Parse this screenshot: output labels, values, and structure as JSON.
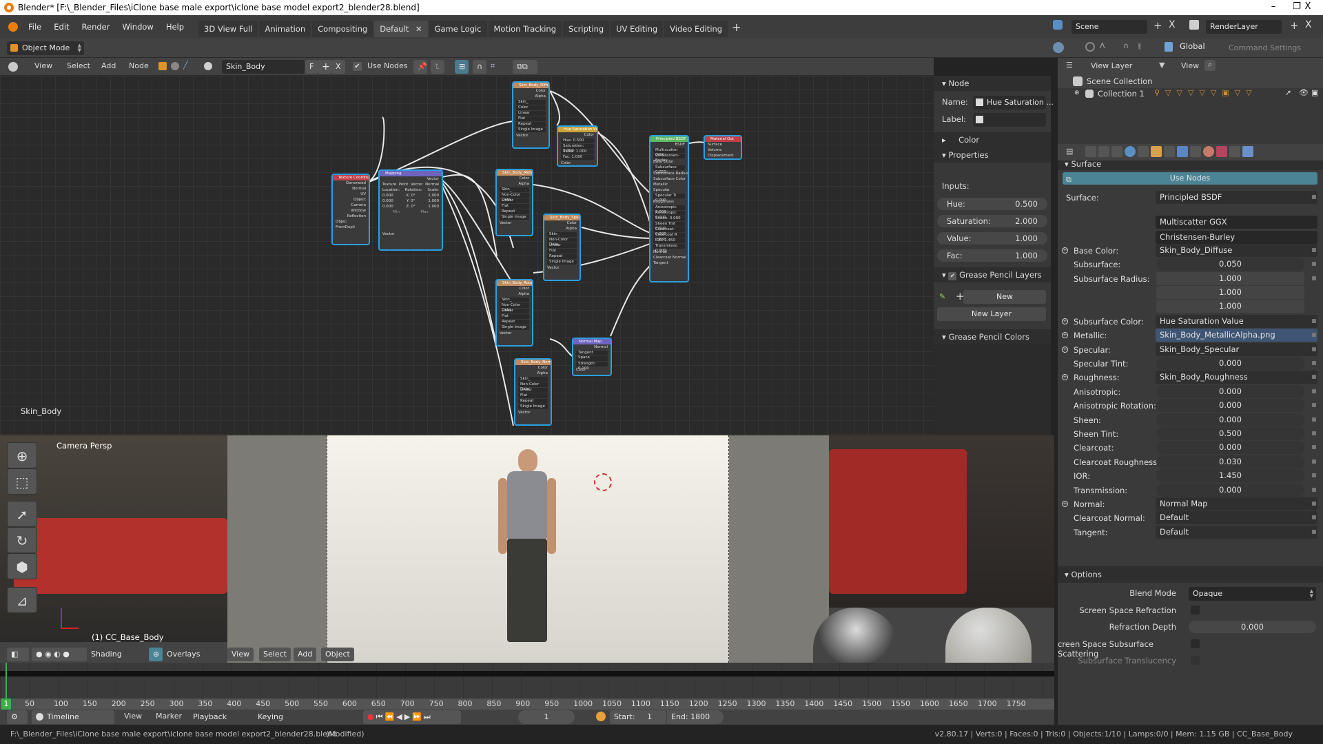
{
  "window": {
    "title": "Blender* [F:\\_Blender_Files\\iClone base male export\\iclone base model export2_blender28.blend]",
    "minimize": "–",
    "maximize": "❐",
    "close": "X"
  },
  "menu": [
    "File",
    "Edit",
    "Render",
    "Window",
    "Help"
  ],
  "workspaces": [
    {
      "label": "3D View Full"
    },
    {
      "label": "Animation"
    },
    {
      "label": "Compositing"
    },
    {
      "label": "Default",
      "active": true,
      "close": "✕"
    },
    {
      "label": "Game Logic"
    },
    {
      "label": "Motion Tracking"
    },
    {
      "label": "Scripting"
    },
    {
      "label": "UV Editing"
    },
    {
      "label": "Video Editing"
    }
  ],
  "add_workspace": "+",
  "scene": {
    "name": "Scene",
    "render_layer": "RenderLayer",
    "add": "+",
    "remove": "X"
  },
  "header2": {
    "mode": "Object Mode",
    "transform_orientation": "Global",
    "command_settings": "Command Settings"
  },
  "node_header": {
    "menus": [
      "View",
      "Select",
      "Add",
      "Node"
    ],
    "material": "Skin_Body",
    "fake_user": "F",
    "new": "+",
    "unlink": "X",
    "use_nodes": "Use Nodes",
    "use_nodes_checked": true
  },
  "node_editor": {
    "label": "Skin_Body",
    "nodes": {
      "texcoord": {
        "title": "Texture Coordinate",
        "outputs": [
          "Generated",
          "Normal",
          "UV",
          "Object",
          "Camera",
          "Window",
          "Reflection"
        ],
        "object_label": "Objec:",
        "from_dupli": "FromDupli"
      },
      "mapping": {
        "title": "Mapping",
        "out": "Vector",
        "tabs": [
          "Texture",
          "Point",
          "Vector",
          "Normal"
        ],
        "loc_label": "Location:",
        "rot_label": "Rotation:",
        "scale_label": "Scale:",
        "loc": [
          "0.000",
          "0.000",
          "0.000"
        ],
        "rot": [
          "X: 0°",
          "Y: 0°",
          "Z: 0°"
        ],
        "scale": [
          "1.000",
          "1.000",
          "1.000"
        ],
        "min": "Min",
        "max": "Max",
        "in": "Vector"
      },
      "diffuse": {
        "title": "Skin_Body_Diffuse",
        "opts": [
          "Color",
          "Linear",
          "Flat",
          "Repeat",
          "Single Image"
        ]
      },
      "metallic": {
        "title": "Skin_Body_Metallic",
        "opts": [
          "Non-Color Data",
          "Linear",
          "Flat",
          "Repeat",
          "Single Image"
        ]
      },
      "specular": {
        "title": "Skin_Body_Specul",
        "opts": [
          "Non-Color Data",
          "Linear",
          "Flat",
          "Repeat",
          "Single Image"
        ]
      },
      "rough": {
        "title": "Skin_Body_Rough",
        "opts": [
          "Non-Color Data",
          "Linear",
          "Flat",
          "Repeat",
          "Single Image"
        ]
      },
      "normal_tex": {
        "title": "Skin_Body_Normal",
        "opts": [
          "Non-Color Data",
          "Linear",
          "Flat",
          "Repeat",
          "Single Image"
        ]
      },
      "hsv": {
        "title": "Hue Saturation Val...",
        "out": "Color",
        "rows": [
          "Hue: 0.500",
          "Saturation: 2.000",
          "Value: 1.000",
          "Fac: 1.000"
        ],
        "in": "Color"
      },
      "normal_map": {
        "title": "Normal Map",
        "out": "Normal",
        "space": "Tangent Space",
        "strength": "Strength: 0.100",
        "in": "Color"
      },
      "bsdf": {
        "title": "Principled BSDF",
        "out": "BSDF",
        "rows": [
          "Multiscatter GGX",
          "Christensen-Burley",
          "Base Color",
          "Subsurface 0.050",
          "Subsurface Radius",
          "Subsurface Color",
          "Metallic",
          "Specular",
          "Specular Ti 0.000",
          "Roughness",
          "Anisotropic 0.000",
          "Anisotropic 0.000",
          "Sheen: 0.000",
          "Sheen Tint 0.500",
          "Clearcoat: 0.000",
          "Clearcoat R 0.030",
          "IOR: 1.450",
          "Transmissio 0.000",
          "Normal",
          "Clearcoat Normal",
          "Tangent"
        ]
      },
      "output": {
        "title": "Material Out",
        "rows": [
          "Surface",
          "Volume",
          "Displacement"
        ]
      },
      "common": {
        "color": "Color",
        "alpha": "Alpha",
        "vector": "Vector",
        "img": "Skin_"
      }
    }
  },
  "npanel": {
    "node_section": "Node",
    "name_label": "Name:",
    "name_value": "Hue Saturation ...",
    "label_label": "Label:",
    "color_section": "Color",
    "properties_section": "Properties",
    "inputs_label": "Inputs:",
    "inputs": [
      {
        "label": "Hue:",
        "value": "0.500"
      },
      {
        "label": "Saturation:",
        "value": "2.000"
      },
      {
        "label": "Value:",
        "value": "1.000"
      },
      {
        "label": "Fac:",
        "value": "1.000"
      }
    ],
    "gp_layers": "Grease Pencil Layers",
    "gp_new": "New",
    "gp_new_layer": "New Layer",
    "gp_colors": "Grease Pencil Colors"
  },
  "outliner": {
    "display_mode": "View Layer",
    "view": "View",
    "scene_collection": "Scene Collection",
    "collection": "Collection 1"
  },
  "properties": {
    "surface_section": "Surface",
    "use_nodes": "Use Nodes",
    "surface_label": "Surface:",
    "surface_value": "Principled BSDF",
    "distribution": "Multiscatter GGX",
    "subsurface_method": "Christensen-Burley",
    "rows": [
      {
        "label": "Base Color:",
        "value": "Skin_Body_Diffuse",
        "type": "link",
        "dot": true
      },
      {
        "label": "Subsurface:",
        "value": "0.050",
        "type": "num"
      },
      {
        "label": "Subsurface Radius:",
        "value": "1.000",
        "type": "vec",
        "values": [
          "1.000",
          "1.000",
          "1.000"
        ]
      },
      {
        "label": "Subsurface Color:",
        "value": "Hue Saturation Value",
        "type": "link",
        "dot": true
      },
      {
        "label": "Metallic:",
        "value": "Skin_Body_MetallicAlpha.png",
        "type": "link",
        "dot": true,
        "highlight": true
      },
      {
        "label": "Specular:",
        "value": "Skin_Body_Specular",
        "type": "link",
        "dot": true
      },
      {
        "label": "Specular Tint:",
        "value": "0.000",
        "type": "num"
      },
      {
        "label": "Roughness:",
        "value": "Skin_Body_Roughness",
        "type": "link",
        "dot": true
      },
      {
        "label": "Anisotropic:",
        "value": "0.000",
        "type": "num"
      },
      {
        "label": "Anisotropic Rotation:",
        "value": "0.000",
        "type": "num"
      },
      {
        "label": "Sheen:",
        "value": "0.000",
        "type": "num"
      },
      {
        "label": "Sheen Tint:",
        "value": "0.500",
        "type": "num"
      },
      {
        "label": "Clearcoat:",
        "value": "0.000",
        "type": "num"
      },
      {
        "label": "Clearcoat Roughness:",
        "value": "0.030",
        "type": "num"
      },
      {
        "label": "IOR:",
        "value": "1.450",
        "type": "num"
      },
      {
        "label": "Transmission:",
        "value": "0.000",
        "type": "num"
      },
      {
        "label": "Normal:",
        "value": "Normal Map",
        "type": "link",
        "dot": true
      },
      {
        "label": "Clearcoat Normal:",
        "value": "Default",
        "type": "link"
      },
      {
        "label": "Tangent:",
        "value": "Default",
        "type": "link"
      }
    ],
    "options_section": "Options",
    "blend_mode_label": "Blend Mode",
    "blend_mode": "Opaque",
    "ssr_label": "Screen Space Refraction",
    "refraction_depth_label": "Refraction Depth",
    "refraction_depth": "0.000",
    "sss_label": "creen Space Subsurface Scattering",
    "translucency_label": "Subsurface Translucency"
  },
  "viewport": {
    "view_name": "Camera Persp",
    "object": "(1) CC_Base_Body",
    "header": {
      "shading": "Shading",
      "overlays": "Overlays",
      "menus": [
        "View",
        "Select",
        "Add",
        "Object"
      ]
    }
  },
  "timeline": {
    "ticks": [
      "1",
      "50",
      "100",
      "150",
      "200",
      "250",
      "300",
      "350",
      "400",
      "450",
      "500",
      "550",
      "600",
      "650",
      "700",
      "750",
      "800",
      "850",
      "900",
      "950",
      "1000",
      "1050",
      "1100",
      "1150",
      "1200",
      "1250",
      "1300",
      "1350",
      "1400",
      "1450",
      "1500",
      "1550",
      "1600",
      "1650",
      "1700",
      "1750"
    ],
    "editor": "Timeline",
    "menus": [
      "View",
      "Marker"
    ],
    "playback": "Playback",
    "keying": "Keying",
    "current_frame": "1",
    "start": "Start:",
    "start_value": "1",
    "end": "End: 1800"
  },
  "statusbar": {
    "file": "F:\\_Blender_Files\\iClone base male export\\iclone base model export2_blender28.blend",
    "modified": "(Modified)",
    "stats": "v2.80.17 | Verts:0 | Faces:0 | Tris:0 | Objects:1/10 | Lamps:0/0 | Mem: 1.15 GB | CC_Base_Body"
  }
}
